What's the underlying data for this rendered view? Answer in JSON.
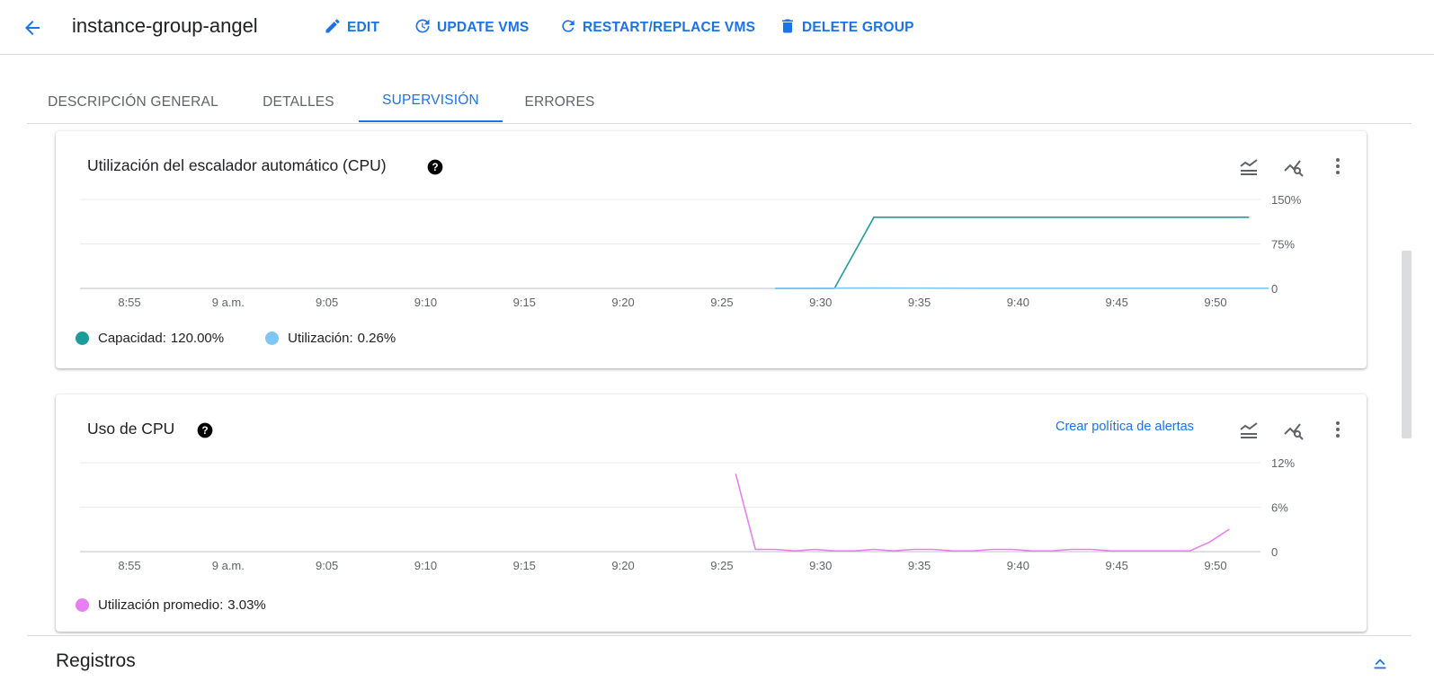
{
  "header": {
    "title": "instance-group-angel",
    "actions": [
      {
        "label": "EDIT",
        "icon": "pencil-icon"
      },
      {
        "label": "UPDATE VMS",
        "icon": "update-icon"
      },
      {
        "label": "RESTART/REPLACE VMS",
        "icon": "refresh-icon"
      },
      {
        "label": "DELETE GROUP",
        "icon": "trash-icon"
      }
    ]
  },
  "tabs": [
    {
      "label": "DESCRIPCIÓN GENERAL",
      "active": false
    },
    {
      "label": "DETALLES",
      "active": false
    },
    {
      "label": "SUPERVISIÓN",
      "active": true
    },
    {
      "label": "ERRORES",
      "active": false
    }
  ],
  "colors": {
    "accent": "#1a73e8",
    "capacity": "#1e9c9c",
    "utilization": "#7cc7f5",
    "avg_util": "#e77ff0"
  },
  "cards": {
    "autoscaler": {
      "title": "Utilización del escalador automático (CPU)",
      "icons": [
        "legend-toggle-icon",
        "explore-chart-icon",
        "more-vert-icon"
      ]
    },
    "cpu": {
      "title": "Uso de CPU",
      "alert_link": "Crear política de alertas",
      "icons": [
        "legend-toggle-icon",
        "explore-chart-icon",
        "more-vert-icon"
      ]
    }
  },
  "chart_data": [
    {
      "type": "line",
      "title": "Utilización del escalador automático (CPU)",
      "x_ticks": [
        "8:55",
        "9 a.m.",
        "9:05",
        "9:10",
        "9:15",
        "9:20",
        "9:25",
        "9:30",
        "9:35",
        "9:40",
        "9:45",
        "9:50"
      ],
      "y_ticks": [
        "150%",
        "75%",
        "0"
      ],
      "ylim": [
        0,
        150
      ],
      "xlim_minutes": [
        0,
        57.5
      ],
      "grid": true,
      "legend_position": "bottom-left",
      "series": [
        {
          "name": "Capacidad",
          "legend_value": "120.00%",
          "color": "#1e9c9c",
          "points": [
            [
              32.7,
              0
            ],
            [
              35.7,
              0
            ],
            [
              37.7,
              120
            ],
            [
              47.7,
              120
            ],
            [
              56.7,
              120
            ]
          ]
        },
        {
          "name": "Utilización",
          "legend_value": "0.26%",
          "color": "#7cc7f5",
          "points": [
            [
              32.7,
              0.26
            ],
            [
              37.7,
              0.6
            ],
            [
              42.7,
              0.26
            ],
            [
              47.7,
              0.26
            ],
            [
              52.7,
              0.26
            ],
            [
              57.7,
              0.26
            ]
          ]
        }
      ]
    },
    {
      "type": "line",
      "title": "Uso de CPU",
      "x_ticks": [
        "8:55",
        "9 a.m.",
        "9:05",
        "9:10",
        "9:15",
        "9:20",
        "9:25",
        "9:30",
        "9:35",
        "9:40",
        "9:45",
        "9:50"
      ],
      "y_ticks": [
        "12%",
        "6%",
        "0"
      ],
      "ylim": [
        0,
        12
      ],
      "xlim_minutes": [
        0,
        57.5
      ],
      "grid": true,
      "legend_position": "bottom-left",
      "series": [
        {
          "name": "Utilización promedio",
          "legend_value": "3.03%",
          "color": "#e77ff0",
          "points": [
            [
              30.7,
              10.5
            ],
            [
              31.7,
              0.3
            ],
            [
              32.7,
              0.3
            ],
            [
              33.7,
              0.1
            ],
            [
              34.7,
              0.3
            ],
            [
              35.7,
              0.1
            ],
            [
              36.7,
              0.1
            ],
            [
              37.7,
              0.3
            ],
            [
              38.7,
              0.1
            ],
            [
              39.7,
              0.3
            ],
            [
              40.7,
              0.3
            ],
            [
              41.7,
              0.1
            ],
            [
              42.7,
              0.1
            ],
            [
              43.7,
              0.3
            ],
            [
              44.7,
              0.3
            ],
            [
              45.7,
              0.1
            ],
            [
              46.7,
              0.1
            ],
            [
              47.7,
              0.3
            ],
            [
              48.7,
              0.3
            ],
            [
              49.7,
              0.1
            ],
            [
              50.7,
              0.1
            ],
            [
              51.7,
              0.1
            ],
            [
              52.7,
              0.1
            ],
            [
              53.7,
              0.1
            ],
            [
              54.7,
              1.3
            ],
            [
              55.7,
              3.03
            ]
          ]
        }
      ]
    }
  ],
  "registros": {
    "title": "Registros"
  }
}
